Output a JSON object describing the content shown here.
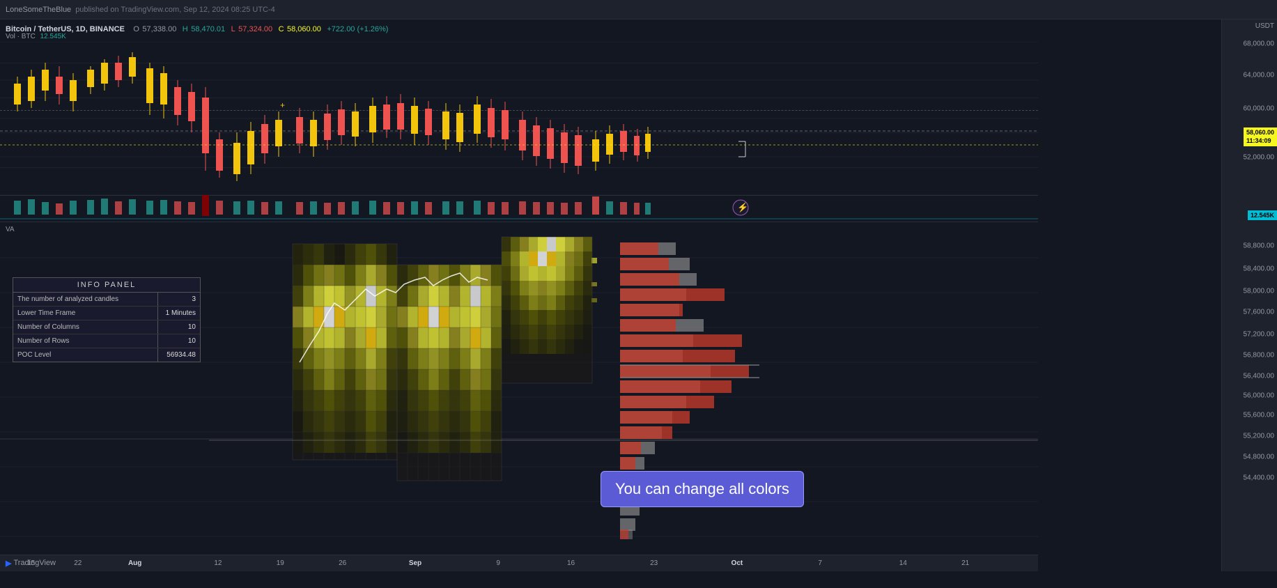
{
  "header": {
    "publisher": "LoneSomeTheBlue",
    "published_on": "published on TradingView.com, Sep 12, 2024 08:25 UTC-4"
  },
  "chart": {
    "symbol": "Bitcoin / TetherUS, 1D, BINANCE",
    "ohlc": {
      "open_label": "O",
      "open_val": "57,338.00",
      "high_label": "H",
      "high_val": "58,470.01",
      "low_label": "L",
      "low_val": "57,324.00",
      "close_label": "C",
      "close_val": "58,060.00",
      "change": "+722.00 (+1.26%)"
    },
    "vol_label": "Vol · BTC",
    "vol_val": "12.545K",
    "current_price": "58,060.00",
    "current_time": "11:34:09",
    "vol_scale_val": "12.545K",
    "va_label": "VA"
  },
  "price_scale": {
    "labels": [
      {
        "price": "68,000.00",
        "pct": 2
      },
      {
        "price": "64,000.00",
        "pct": 14
      },
      {
        "price": "60,000.00",
        "pct": 26
      },
      {
        "price": "52,000.00",
        "pct": 52
      },
      {
        "price": "58,800.00",
        "pct": 60
      },
      {
        "price": "58,400.00",
        "pct": 66
      },
      {
        "price": "58,000.00",
        "pct": 72
      },
      {
        "price": "57,600.00",
        "pct": 77
      },
      {
        "price": "57,200.00",
        "pct": 82
      },
      {
        "price": "56,800.00",
        "pct": 87
      },
      {
        "price": "56,400.00",
        "pct": 91
      },
      {
        "price": "56,000.00",
        "pct": 93
      },
      {
        "price": "55,600.00",
        "pct": 95
      },
      {
        "price": "55,200.00",
        "pct": 97
      },
      {
        "price": "54,800.00",
        "pct": 99
      },
      {
        "price": "54,400.00",
        "pct": 100
      }
    ]
  },
  "date_labels": [
    {
      "label": "15",
      "left_pct": 3
    },
    {
      "label": "22",
      "left_pct": 7.5
    },
    {
      "label": "Aug",
      "left_pct": 13
    },
    {
      "label": "12",
      "left_pct": 21
    },
    {
      "label": "19",
      "left_pct": 27
    },
    {
      "label": "26",
      "left_pct": 33
    },
    {
      "label": "Sep",
      "left_pct": 40
    },
    {
      "label": "9",
      "left_pct": 48
    },
    {
      "label": "16",
      "left_pct": 55
    },
    {
      "label": "23",
      "left_pct": 63
    },
    {
      "label": "Oct",
      "left_pct": 71
    },
    {
      "label": "7",
      "left_pct": 79
    },
    {
      "label": "14",
      "left_pct": 87
    },
    {
      "label": "21",
      "left_pct": 93
    }
  ],
  "info_panel": {
    "title": "INFO PANEL",
    "rows": [
      {
        "label": "The number of analyzed candles",
        "value": "3"
      },
      {
        "label": "Lower Time Frame",
        "value": "1 Minutes"
      },
      {
        "label": "Number of Columns",
        "value": "10"
      },
      {
        "label": "Number of Rows",
        "value": "10"
      },
      {
        "label": "POC Level",
        "value": "56934.48"
      }
    ]
  },
  "tooltip": {
    "text": "You can change all colors"
  },
  "colors": {
    "bull_candle": "#26a69a",
    "bear_candle": "#ef5350",
    "bull_candle_yellow": "#f2c40c",
    "bear_candle_dark": "#b71c1c",
    "volume_bull": "#26a69a",
    "volume_bear": "#ef5350",
    "grid_line": "#1e2230",
    "background": "#131722"
  }
}
